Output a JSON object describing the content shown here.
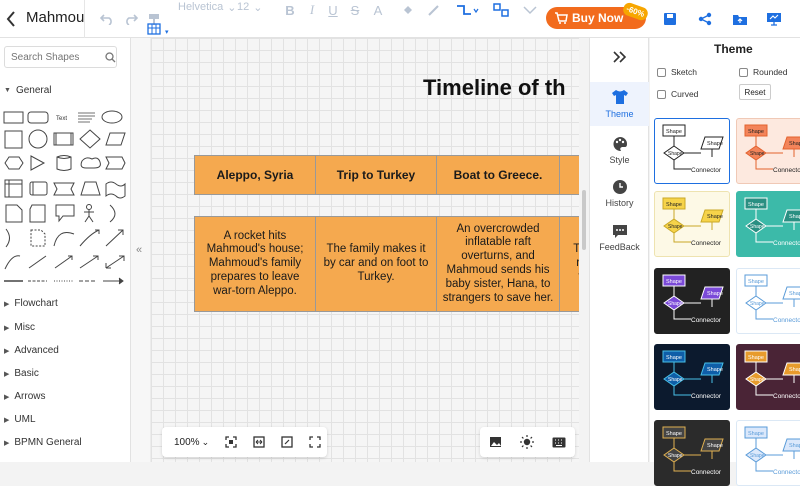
{
  "app": {
    "title": "Mahmou",
    "buy_label": "Buy Now",
    "discount": "-60%"
  },
  "toolbar": {
    "font": "Helvetica",
    "size": "12"
  },
  "left": {
    "search_placeholder": "Search Shapes",
    "general": "General",
    "shape_text_label": "Text",
    "categories": [
      "Flowchart",
      "Misc",
      "Advanced",
      "Basic",
      "Arrows",
      "UML",
      "BPMN General"
    ]
  },
  "canvas": {
    "title": "Timeline of th",
    "headers": [
      "Aleppo, Syria",
      "Trip to Turkey",
      "Boat to Greece.",
      ""
    ],
    "bodies": [
      "A rocket hits Mahmoud's house; Mahmoud's family prepares to leave war-torn Aleppo.",
      "The family makes it by car and on foot to Turkey.",
      "An overcrowded inflatable raft overturns, and Mahmoud sends his baby sister, Hana, to strangers to save her.",
      "T th ref th"
    ],
    "zoom": "100%"
  },
  "rightnav": {
    "items": [
      "Theme",
      "Style",
      "History",
      "FeedBack"
    ],
    "active": "Theme"
  },
  "theme": {
    "title": "Theme",
    "options": [
      "Sketch",
      "Rounded",
      "Curved"
    ],
    "reset_label": "Reset",
    "thumb_shape": "Shape",
    "thumb_connector": "Connector"
  },
  "colors": {
    "accent": "#1e6fe0",
    "cell": "#f5a94f",
    "buy": "#f26b1d"
  }
}
